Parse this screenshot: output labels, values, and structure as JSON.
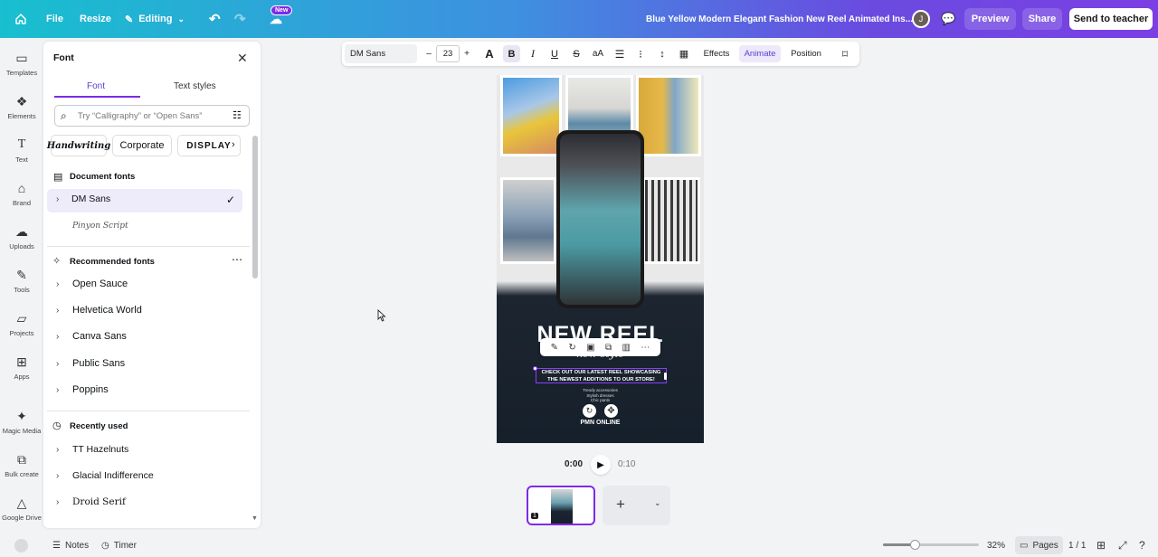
{
  "topbar": {
    "menu": [
      "File",
      "Resize",
      "Editing"
    ],
    "new_badge": "New",
    "title": "Blue Yellow Modern Elegant Fashion New Reel Animated Ins...",
    "avatar": "J",
    "preview": "Preview",
    "share": "Share",
    "send": "Send to teacher"
  },
  "rail": [
    "Templates",
    "Elements",
    "Text",
    "Brand",
    "Uploads",
    "Tools",
    "Projects",
    "Apps",
    "Magic Media",
    "Bulk create",
    "Google Drive"
  ],
  "panel": {
    "title": "Font",
    "tabs": [
      "Font",
      "Text styles"
    ],
    "search_placeholder": "Try “Calligraphy” or “Open Sans”",
    "chips": [
      "Handwriting",
      "Corporate",
      "DISPLAY"
    ],
    "document_fonts_label": "Document fonts",
    "document_fonts": [
      "DM Sans",
      "Pinyon Script"
    ],
    "recommended_label": "Recommended fonts",
    "recommended": [
      "Open Sauce",
      "Helvetica World",
      "Canva Sans",
      "Public Sans",
      "Poppins"
    ],
    "recent_label": "Recently used",
    "recent": [
      "TT Hazelnuts",
      "Glacial Indifference",
      "Droid Serif"
    ]
  },
  "toolbar": {
    "font": "DM Sans",
    "minus": "–",
    "size": "23",
    "plus": "+",
    "effects": "Effects",
    "animate": "Animate",
    "position": "Position"
  },
  "design": {
    "headline": "NEW REEL",
    "script": "new style",
    "caption": "CHECK OUT OUR LATEST REEL SHOWCASING THE NEWEST ADDITIONS TO OUR STORE!",
    "list": [
      "Trendy accessories",
      "Stylish dresses",
      "Chic pants"
    ],
    "brand": "PMN ONLINE"
  },
  "playback": {
    "current": "0:00",
    "total": "0:10"
  },
  "page_thumb_number": "1",
  "bottom": {
    "notes": "Notes",
    "timer": "Timer",
    "zoom": "32%",
    "pages": "Pages",
    "page_count": "1 / 1",
    "zoom_fraction": 0.33
  },
  "colors": {
    "accent": "#7d2ae8",
    "selected_row": "#eeebfa"
  }
}
